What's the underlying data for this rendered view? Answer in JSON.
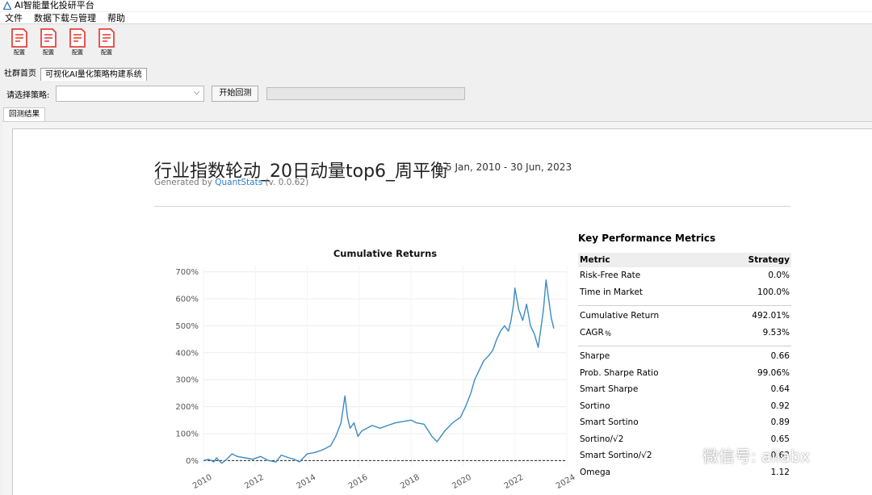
{
  "window": {
    "title": "AI智能量化投研平台"
  },
  "menu": [
    "文件",
    "数据下载与管理",
    "帮助"
  ],
  "toolbar": {
    "buttons": [
      {
        "label": "配置"
      },
      {
        "label": "配置"
      },
      {
        "label": "配置"
      },
      {
        "label": "配置"
      }
    ]
  },
  "tabs": [
    "社群首页",
    "可视化AI量化策略构建系统"
  ],
  "controls": {
    "strategy_label": "请选择策略:",
    "strategy_value": "",
    "run_label": "开始回测"
  },
  "result_tab": "回测结果",
  "report": {
    "title": "行业指数轮动_20日动量top6_周平衡",
    "date_range": "5 Jan, 2010 - 30 Jun, 2023",
    "generated_by": "Generated by",
    "generator": "QuantStats",
    "version": "(v. 0.0.62)"
  },
  "metrics": {
    "heading": "Key Performance Metrics",
    "col_metric": "Metric",
    "col_strategy": "Strategy",
    "groups": [
      [
        {
          "name": "Risk-Free Rate",
          "value": "0.0%"
        },
        {
          "name": "Time in Market",
          "value": "100.0%"
        }
      ],
      [
        {
          "name": "Cumulative Return",
          "value": "492.01%"
        },
        {
          "name": "CAGR﹪",
          "value": "9.53%"
        }
      ],
      [
        {
          "name": "Sharpe",
          "value": "0.66"
        },
        {
          "name": "Prob. Sharpe Ratio",
          "value": "99.06%"
        },
        {
          "name": "Smart Sharpe",
          "value": "0.64"
        },
        {
          "name": "Sortino",
          "value": "0.92"
        },
        {
          "name": "Smart Sortino",
          "value": "0.89"
        },
        {
          "name": "Sortino/√2",
          "value": "0.65"
        },
        {
          "name": "Smart Sortino/√2",
          "value": "0.63"
        },
        {
          "name": "Omega",
          "value": "1.12"
        }
      ]
    ]
  },
  "watermark": {
    "text": "微信号: ailabx"
  },
  "colors": {
    "line": "#3b8bc2",
    "accent_red": "#e8433c",
    "link": "#2a7fc4"
  },
  "chart_data": {
    "type": "line",
    "title": "Cumulative Returns",
    "xlabel": "",
    "ylabel": "",
    "x_ticks": [
      "2010",
      "2012",
      "2014",
      "2016",
      "2018",
      "2020",
      "2022",
      "2024"
    ],
    "y_ticks": [
      "0%",
      "100%",
      "200%",
      "300%",
      "400%",
      "500%",
      "600%",
      "700%"
    ],
    "xlim": [
      2010,
      2024
    ],
    "ylim": [
      -20,
      720
    ],
    "baseline": 0,
    "series": [
      {
        "x": [
          2010.0,
          2010.2,
          2010.4,
          2010.5,
          2010.7,
          2010.9,
          2011.1,
          2011.3,
          2011.6,
          2011.9,
          2012.2,
          2012.5,
          2012.8,
          2013.0,
          2013.3,
          2013.5,
          2013.7,
          2014.0,
          2014.3,
          2014.6,
          2014.9,
          2015.1,
          2015.3,
          2015.45,
          2015.55,
          2015.65,
          2015.8,
          2015.95,
          2016.1,
          2016.3,
          2016.5,
          2016.8,
          2017.1,
          2017.4,
          2017.7,
          2018.0,
          2018.2,
          2018.5,
          2018.8,
          2019.0,
          2019.15,
          2019.3,
          2019.6,
          2019.9,
          2020.1,
          2020.3,
          2020.45,
          2020.6,
          2020.8,
          2021.0,
          2021.15,
          2021.3,
          2021.45,
          2021.6,
          2021.75,
          2021.85,
          2021.95,
          2022.0,
          2022.15,
          2022.3,
          2022.45,
          2022.6,
          2022.75,
          2022.9,
          2023.0,
          2023.1,
          2023.2,
          2023.3,
          2023.4,
          2023.5
        ],
        "y": [
          0,
          5,
          -5,
          10,
          -10,
          5,
          25,
          15,
          10,
          5,
          15,
          0,
          -5,
          20,
          10,
          5,
          -5,
          25,
          30,
          40,
          55,
          90,
          140,
          240,
          160,
          120,
          140,
          90,
          110,
          120,
          130,
          120,
          130,
          140,
          145,
          150,
          140,
          135,
          90,
          70,
          90,
          110,
          140,
          160,
          200,
          250,
          300,
          330,
          370,
          390,
          410,
          450,
          480,
          500,
          480,
          520,
          580,
          640,
          560,
          520,
          580,
          500,
          470,
          420,
          490,
          560,
          670,
          600,
          530,
          490
        ]
      }
    ]
  }
}
